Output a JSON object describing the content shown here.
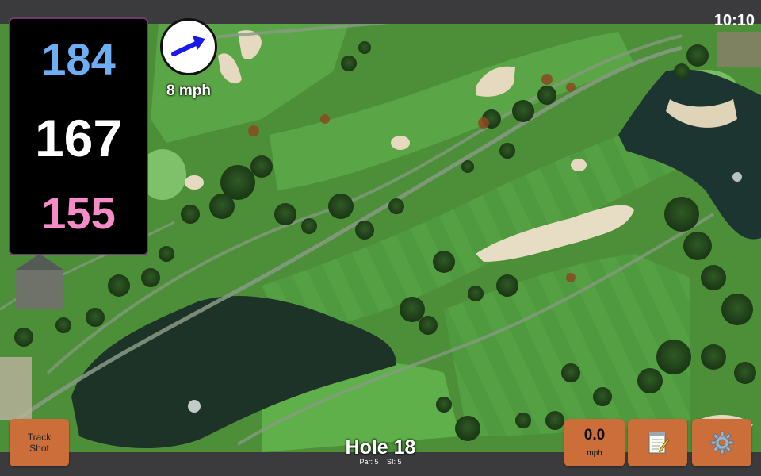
{
  "status": {
    "time": "10:10"
  },
  "distances": {
    "back": "184",
    "center": "167",
    "front": "155",
    "back_color": "#6eaef5",
    "center_color": "#ffffff",
    "front_color": "#f58cc8"
  },
  "wind": {
    "speed_label": "8 mph",
    "direction_icon": "arrow-icon",
    "arrow_color": "#1a1ae6"
  },
  "hole": {
    "title": "Hole 18",
    "par": "Par: 5",
    "si": "SI: 5"
  },
  "buttons": {
    "track_shot_line1": "Track",
    "track_shot_line2": "Shot",
    "wind_value": "0.0",
    "wind_unit": "mph",
    "notes_icon": "notepad-icon",
    "settings_icon": "gear-icon",
    "accent": "#cc6e3a"
  },
  "map": {
    "type": "satellite golf course hole view"
  }
}
